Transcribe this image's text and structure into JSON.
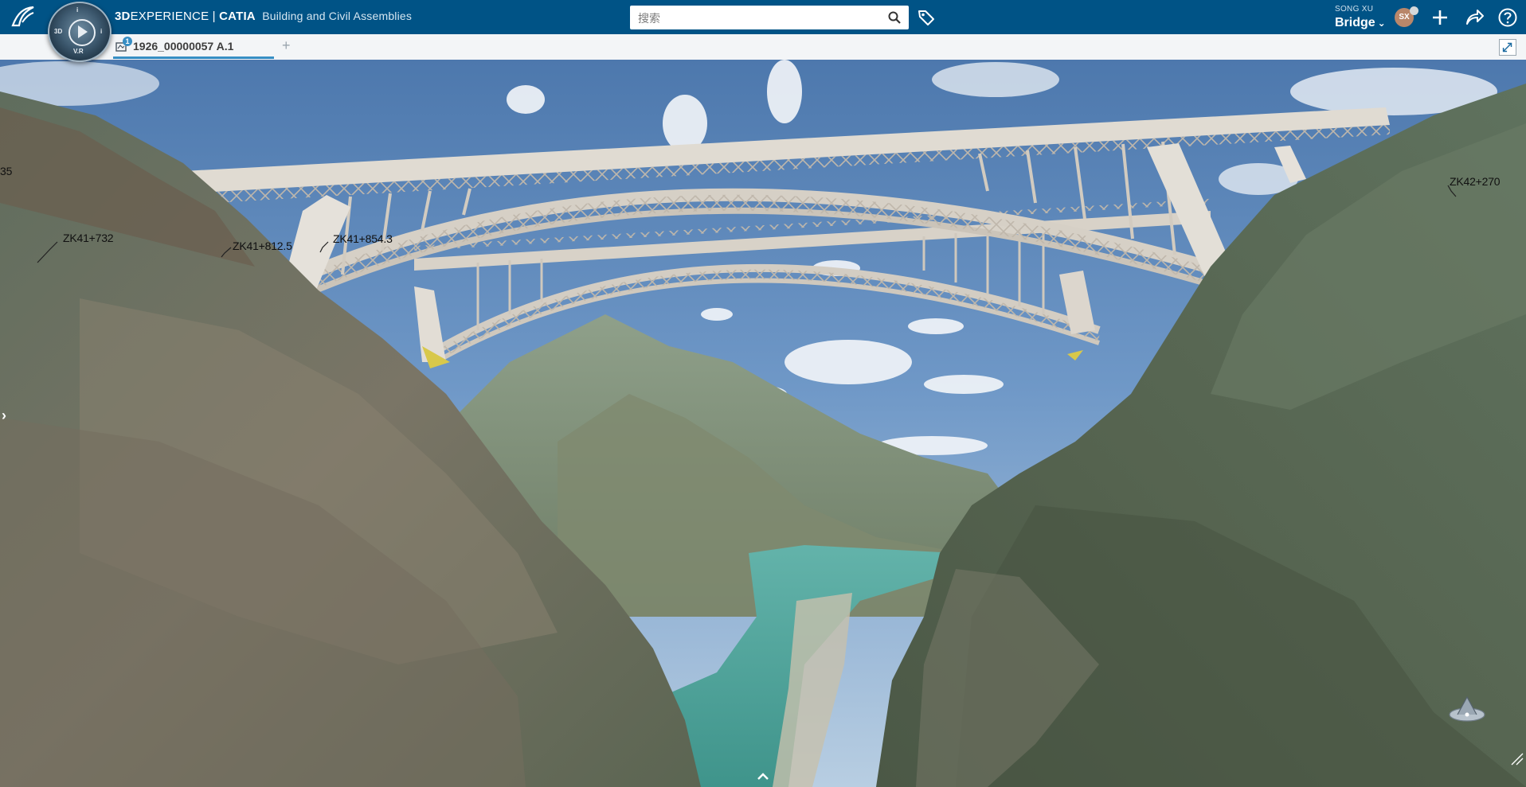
{
  "header": {
    "brand_bold": "3D",
    "brand_rest": "EXPERIENCE",
    "separator": " | ",
    "app_name": "CATIA",
    "app_role": "Building and Civil Assemblies",
    "compass_labels": {
      "top": "i",
      "left": "3D",
      "right": "i",
      "bottom": "V.R"
    },
    "search": {
      "placeholder": "搜索",
      "value": ""
    },
    "user_name": "SONG XU",
    "space_name": "Bridge",
    "avatar_initials": "SX",
    "icons": [
      "ds-logo-icon",
      "compass-icon",
      "search-icon",
      "tag-icon",
      "plus-icon",
      "share-icon",
      "help-icon"
    ]
  },
  "tabs": [
    {
      "label": "1926_00000057 A.1",
      "badge": "1",
      "active": true
    }
  ],
  "tab_add": "+",
  "viewport": {
    "station_labels": [
      {
        "text": "35"
      },
      {
        "text": "ZK41+732"
      },
      {
        "text": "ZK41+812.5"
      },
      {
        "text": "ZK41+854.3"
      },
      {
        "text": "ZK42+270"
      }
    ],
    "side_toggle": "›"
  },
  "colors": {
    "topbar": "#005386",
    "tab_accent": "#368ec4",
    "tabbar_bg": "#f3f5f7",
    "bridge": "#d9d3c9",
    "water": "#4fa39a"
  }
}
